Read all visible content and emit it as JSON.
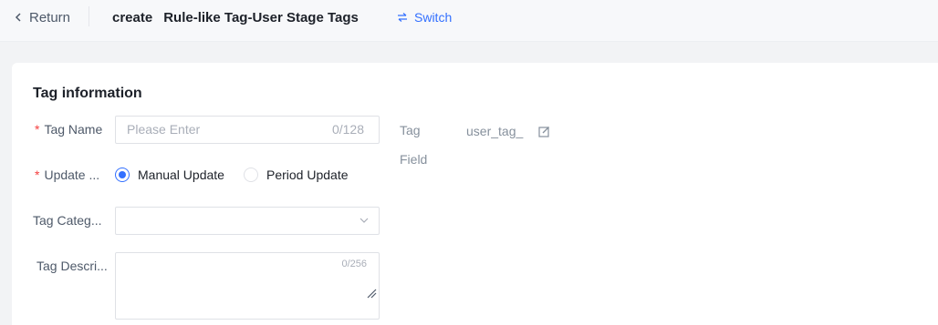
{
  "header": {
    "back_label": "Return",
    "title_action": "create",
    "title_name": "Rule-like Tag-User Stage Tags",
    "switch_label": "Switch"
  },
  "form": {
    "section_title": "Tag information",
    "tag_name": {
      "label": "Tag Name",
      "required_mark": "*",
      "placeholder": "Please Enter",
      "counter": "0/128"
    },
    "update": {
      "label": "Update ...",
      "required_mark": "*",
      "options": [
        {
          "label": "Manual Update",
          "selected": true
        },
        {
          "label": "Period Update",
          "selected": false
        }
      ]
    },
    "category": {
      "label": "Tag Categ..."
    },
    "description": {
      "label": "Tag Descri...",
      "counter": "0/256"
    },
    "tag_field": {
      "label_line1": "Tag",
      "label_line2": "Field",
      "value": "user_tag_"
    }
  },
  "colors": {
    "accent": "#3370ff",
    "required": "#f53f3f"
  },
  "icons": [
    "chevron-left-icon",
    "switch-icon",
    "chevron-down-icon",
    "edit-icon",
    "resize-grip-icon"
  ]
}
